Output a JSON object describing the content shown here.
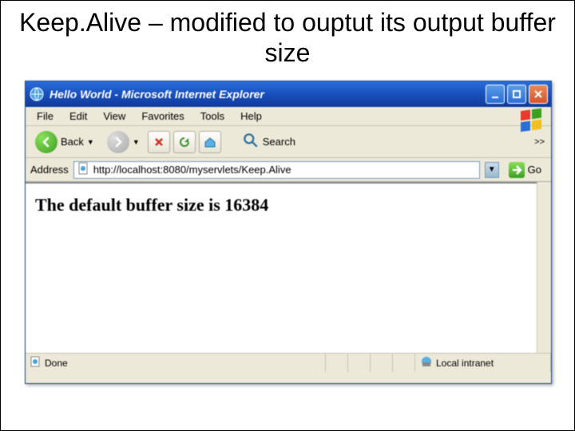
{
  "slide": {
    "title": "Keep.Alive – modified to ouptut its output buffer size"
  },
  "titlebar": {
    "text": "Hello World - Microsoft Internet Explorer"
  },
  "menu": {
    "file": "File",
    "edit": "Edit",
    "view": "View",
    "favorites": "Favorites",
    "tools": "Tools",
    "help": "Help"
  },
  "toolbar": {
    "back": "Back",
    "search": "Search",
    "overflow": ">>"
  },
  "address": {
    "label": "Address",
    "url": "http://localhost:8080/myservlets/Keep.Alive",
    "go": "Go"
  },
  "page": {
    "body_text": "The default buffer size is 16384"
  },
  "status": {
    "done": "Done",
    "zone": "Local intranet"
  }
}
